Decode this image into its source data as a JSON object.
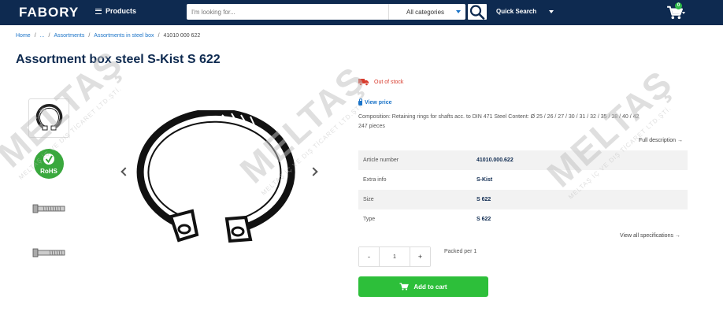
{
  "header": {
    "logo": "FABORY",
    "products_label": "Products",
    "search_placeholder": "I'm looking for...",
    "category_selected": "All categories",
    "quick_search_label": "Quick Search",
    "cart_count": "0"
  },
  "breadcrumb": [
    "Home",
    "...",
    "Assortments",
    "Assortments in steel box",
    "41010 000 622"
  ],
  "product": {
    "title": "Assortment box steel S-Kist S 622",
    "stock_status": "Out of stock",
    "view_price": "View price",
    "composition": "Composition: Retaining rings for shafts acc. to DIN 471 Steel Content: Ø 25 / 26 / 27 / 30 / 31 / 32 / 35 / 38 / 40 / 42",
    "pieces": "247 pieces",
    "full_description": "Full description →",
    "specs": [
      {
        "label": "Article number",
        "value": "41010.000.622"
      },
      {
        "label": "Extra info",
        "value": "S-Kist"
      },
      {
        "label": "Size",
        "value": "S 622"
      },
      {
        "label": "Type",
        "value": "S 622"
      }
    ],
    "view_all_specs": "View all specifications →",
    "qty_minus": "-",
    "quantity": "1",
    "qty_plus": "+",
    "packed_per": "Packed per 1",
    "add_to_cart": "Add to cart"
  },
  "watermark": {
    "brand": "MELTAŞ",
    "company": "MELTAŞ İÇ VE DIŞ TİCARET LTD.ŞTİ."
  },
  "colors": {
    "header_bg": "#0e2a50",
    "link": "#1a73c8",
    "out_of_stock": "#d83b2d",
    "add_to_cart_bg": "#2dbf3a",
    "badge": "#2db84a"
  },
  "icons": [
    "hamburger-icon",
    "search-icon",
    "cart-icon",
    "truck-icon",
    "lock-icon",
    "chevron-left-icon",
    "chevron-right-icon",
    "rohs-icon"
  ]
}
